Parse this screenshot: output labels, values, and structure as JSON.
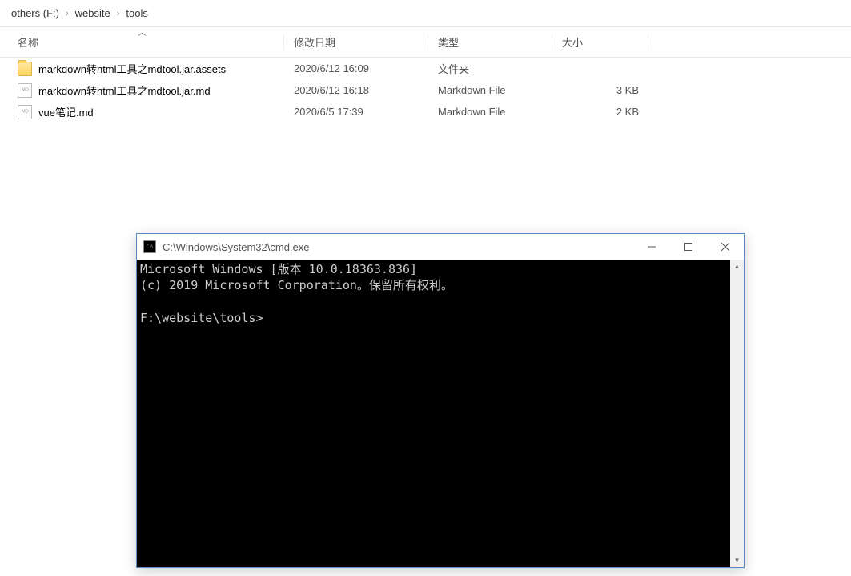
{
  "breadcrumb": {
    "items": [
      {
        "label": "others (F:)"
      },
      {
        "label": "website"
      },
      {
        "label": "tools"
      }
    ]
  },
  "columns": {
    "name": "名称",
    "date": "修改日期",
    "type": "类型",
    "size": "大小",
    "sort_indicator": "︿"
  },
  "files": [
    {
      "icon": "folder",
      "name": "markdown转html工具之mdtool.jar.assets",
      "date": "2020/6/12 16:09",
      "type": "文件夹",
      "size": ""
    },
    {
      "icon": "md",
      "name": "markdown转html工具之mdtool.jar.md",
      "date": "2020/6/12 16:18",
      "type": "Markdown File",
      "size": "3 KB"
    },
    {
      "icon": "md",
      "name": "vue笔记.md",
      "date": "2020/6/5 17:39",
      "type": "Markdown File",
      "size": "2 KB"
    }
  ],
  "cmd": {
    "title": "C:\\Windows\\System32\\cmd.exe",
    "line1": "Microsoft Windows [版本 10.0.18363.836]",
    "line2": "(c) 2019 Microsoft Corporation。保留所有权利。",
    "blank": "",
    "prompt": "F:\\website\\tools>"
  }
}
